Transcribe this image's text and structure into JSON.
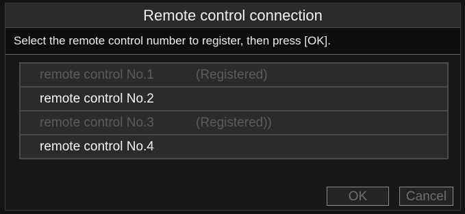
{
  "dialog": {
    "title": "Remote control connection",
    "instruction": "Select the remote control number to register, then press [OK]."
  },
  "remotes": [
    {
      "label": "remote control No.1",
      "status": "(Registered)",
      "enabled": false
    },
    {
      "label": "remote control No.2",
      "status": "",
      "enabled": true
    },
    {
      "label": "remote control No.3",
      "status": "(Registered))",
      "enabled": false
    },
    {
      "label": "remote control No.4",
      "status": "",
      "enabled": true
    }
  ],
  "buttons": {
    "ok_label": "OK",
    "cancel_label": "Cancel"
  },
  "colors": {
    "enabled_text": "#f5f5f5",
    "disabled_text": "#5c5c5c",
    "row_background": "#2b2b2b",
    "row_border": "#4a4a4a"
  }
}
